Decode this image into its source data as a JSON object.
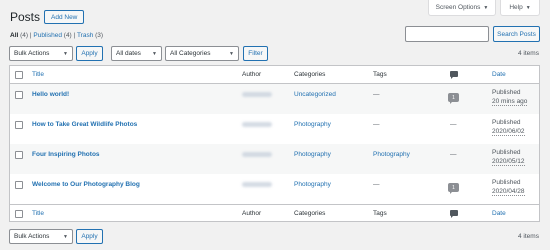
{
  "header": {
    "title": "Posts",
    "add_new_label": "Add New",
    "screen_options_label": "Screen Options",
    "help_label": "Help"
  },
  "filters": {
    "all_label": "All",
    "all_count": "(4)",
    "published_label": "Published",
    "published_count": "(4)",
    "trash_label": "Trash",
    "trash_count": "(3)",
    "separator": "|"
  },
  "search": {
    "placeholder": "",
    "button_label": "Search Posts"
  },
  "tablenav": {
    "bulk_actions": "Bulk Actions",
    "apply_label": "Apply",
    "dates": "All dates",
    "categories": "All Categories",
    "filter_label": "Filter",
    "items_count": "4 items"
  },
  "table": {
    "columns": {
      "title": "Title",
      "author": "Author",
      "categories": "Categories",
      "tags": "Tags",
      "date": "Date"
    },
    "rows": [
      {
        "title": "Hello world!",
        "category": "Uncategorized",
        "tags": "—",
        "comments": "1",
        "status": "Published",
        "date": "20 mins ago"
      },
      {
        "title": "How to Take Great Wildlife Photos",
        "category": "Photography",
        "tags": "—",
        "comments": "—",
        "status": "Published",
        "date": "2020/06/02"
      },
      {
        "title": "Four Inspiring Photos",
        "category": "Photography",
        "tags": "Photography",
        "comments": "—",
        "status": "Published",
        "date": "2020/05/12"
      },
      {
        "title": "Welcome to Our Photography Blog",
        "category": "Photography",
        "tags": "—",
        "comments": "1",
        "status": "Published",
        "date": "2020/04/28"
      }
    ]
  },
  "colors": {
    "link": "#2271b1",
    "background": "#f1f1f1",
    "border": "#c3c4c7"
  }
}
